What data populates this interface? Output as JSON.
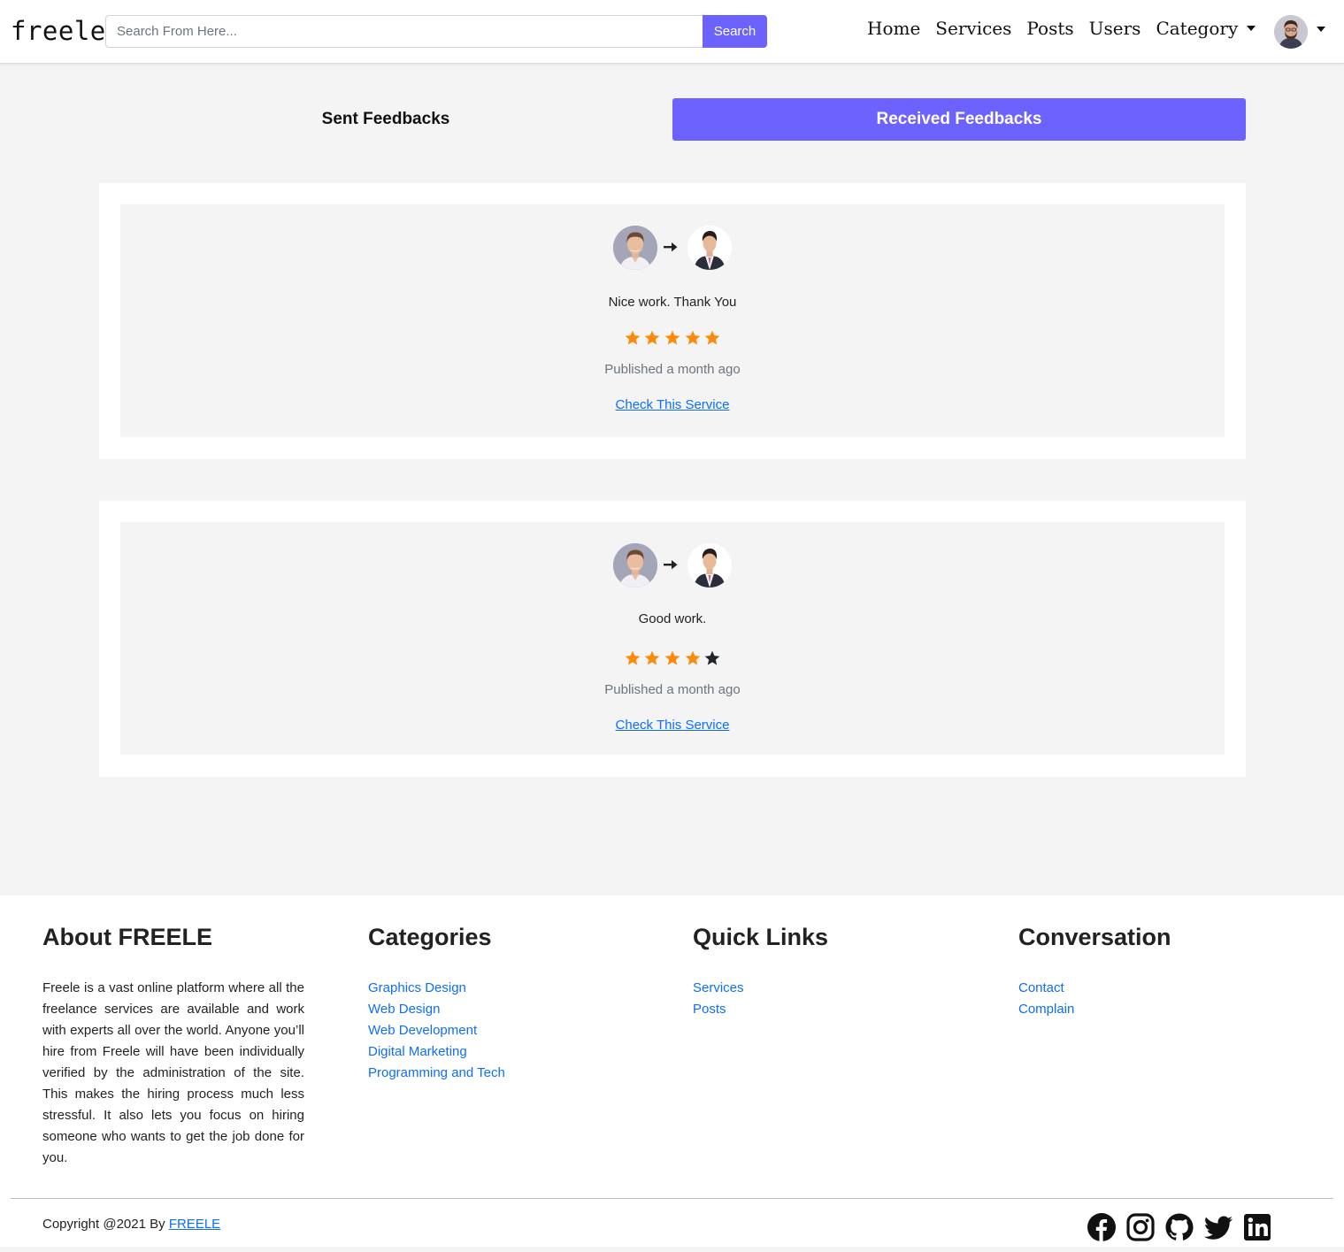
{
  "navbar": {
    "brand": "freele",
    "search_placeholder": "Search From Here...",
    "search_button": "Search",
    "links": [
      "Home",
      "Services",
      "Posts",
      "Users"
    ],
    "category_label": "Category"
  },
  "tabs": {
    "sent": "Sent Feedbacks",
    "received": "Received Feedbacks",
    "active": "received"
  },
  "feedbacks": [
    {
      "comment": "Nice work. Thank You",
      "rating": 5,
      "max_rating": 5,
      "published": "Published a month ago",
      "link": "Check This Service"
    },
    {
      "comment": "Good work.",
      "rating": 4,
      "max_rating": 5,
      "published": "Published a month ago",
      "link": "Check This Service"
    }
  ],
  "footer": {
    "about_title": "About FREELE",
    "about_text": "Freele is a vast online platform where all the freelance services are available and work with experts all over the world. Anyone you’ll hire from Freele will have been individually verified by the administration of the site. This makes the hiring process much less stressful. It also lets you focus on hiring someone who wants to get the job done for you.",
    "categories_title": "Categories",
    "categories": [
      "Graphics Design",
      "Web Design",
      "Web Development",
      "Digital Marketing",
      "Programming and Tech"
    ],
    "quick_links_title": "Quick Links",
    "quick_links": [
      "Services",
      "Posts"
    ],
    "conversation_title": "Conversation",
    "conversation": [
      "Contact",
      "Complain"
    ],
    "copyright_prefix": "Copyright @2021 By ",
    "copyright_brand": "FREELE",
    "socials": [
      "facebook-icon",
      "instagram-icon",
      "github-icon",
      "twitter-icon",
      "linkedin-icon"
    ]
  },
  "colors": {
    "accent": "#6c63ff",
    "star_filled": "#fd8b0b",
    "star_empty": "#212529",
    "link": "#0d6efd",
    "page_bg": "#f4f4f4"
  }
}
